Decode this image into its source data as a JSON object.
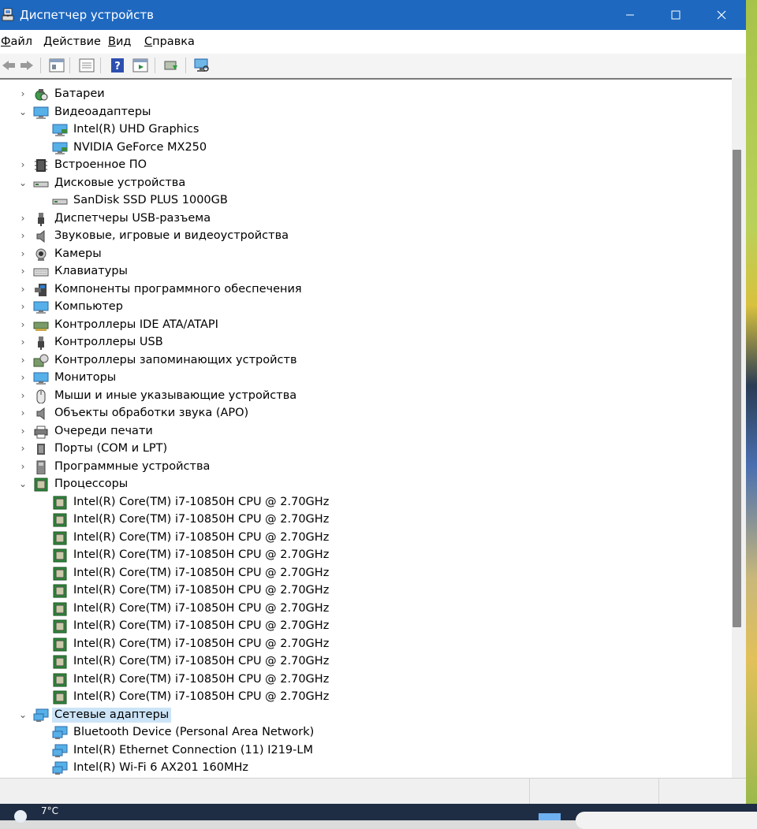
{
  "window": {
    "title": "Диспетчер устройств"
  },
  "menu": [
    {
      "text": "Файл",
      "u": "Ф",
      "rest": "айл"
    },
    {
      "text": "Действие",
      "u": "Д",
      "rest": "ействие"
    },
    {
      "text": "Вид",
      "u": "В",
      "rest": "ид"
    },
    {
      "text": "Справка",
      "u": "С",
      "rest": "правка"
    }
  ],
  "toolbar": [
    "back-icon",
    "forward-icon",
    "properties-icon",
    "show-hide-tree-icon",
    "help-icon",
    "run-icon",
    "update-driver-icon",
    "scan-hardware-icon"
  ],
  "tree": [
    {
      "label": "Батареи",
      "level": 0,
      "state": "collapsed",
      "icon": "battery-icon"
    },
    {
      "label": "Видеоадаптеры",
      "level": 0,
      "state": "expanded",
      "icon": "monitor-icon"
    },
    {
      "label": "Intel(R) UHD Graphics",
      "level": 1,
      "icon": "display-adapter-icon"
    },
    {
      "label": "NVIDIA GeForce MX250",
      "level": 1,
      "icon": "display-adapter-icon"
    },
    {
      "label": "Встроенное ПО",
      "level": 0,
      "state": "collapsed",
      "icon": "firmware-icon"
    },
    {
      "label": "Дисковые устройства",
      "level": 0,
      "state": "expanded",
      "icon": "disk-drive-icon"
    },
    {
      "label": "SanDisk SSD PLUS 1000GB",
      "level": 1,
      "icon": "disk-drive-icon"
    },
    {
      "label": "Диспетчеры USB-разъема",
      "level": 0,
      "state": "collapsed",
      "icon": "usb-icon"
    },
    {
      "label": "Звуковые, игровые и видеоустройства",
      "level": 0,
      "state": "collapsed",
      "icon": "speaker-icon"
    },
    {
      "label": "Камеры",
      "level": 0,
      "state": "collapsed",
      "icon": "camera-icon"
    },
    {
      "label": "Клавиатуры",
      "level": 0,
      "state": "collapsed",
      "icon": "keyboard-icon"
    },
    {
      "label": "Компоненты программного обеспечения",
      "level": 0,
      "state": "collapsed",
      "icon": "software-component-icon"
    },
    {
      "label": "Компьютер",
      "level": 0,
      "state": "collapsed",
      "icon": "monitor-icon"
    },
    {
      "label": "Контроллеры IDE ATA/ATAPI",
      "level": 0,
      "state": "collapsed",
      "icon": "ide-controller-icon"
    },
    {
      "label": "Контроллеры USB",
      "level": 0,
      "state": "collapsed",
      "icon": "usb-icon"
    },
    {
      "label": "Контроллеры запоминающих устройств",
      "level": 0,
      "state": "collapsed",
      "icon": "storage-controller-icon"
    },
    {
      "label": "Мониторы",
      "level": 0,
      "state": "collapsed",
      "icon": "monitor-icon"
    },
    {
      "label": "Мыши и иные указывающие устройства",
      "level": 0,
      "state": "collapsed",
      "icon": "mouse-icon"
    },
    {
      "label": "Объекты обработки звука (APO)",
      "level": 0,
      "state": "collapsed",
      "icon": "speaker-icon"
    },
    {
      "label": "Очереди печати",
      "level": 0,
      "state": "collapsed",
      "icon": "printer-icon"
    },
    {
      "label": "Порты (COM и LPT)",
      "level": 0,
      "state": "collapsed",
      "icon": "port-icon"
    },
    {
      "label": "Программные устройства",
      "level": 0,
      "state": "collapsed",
      "icon": "software-device-icon"
    },
    {
      "label": "Процессоры",
      "level": 0,
      "state": "expanded",
      "icon": "processor-icon"
    },
    {
      "label": "Intel(R) Core(TM) i7-10850H CPU @ 2.70GHz",
      "level": 1,
      "icon": "processor-icon"
    },
    {
      "label": "Intel(R) Core(TM) i7-10850H CPU @ 2.70GHz",
      "level": 1,
      "icon": "processor-icon"
    },
    {
      "label": "Intel(R) Core(TM) i7-10850H CPU @ 2.70GHz",
      "level": 1,
      "icon": "processor-icon"
    },
    {
      "label": "Intel(R) Core(TM) i7-10850H CPU @ 2.70GHz",
      "level": 1,
      "icon": "processor-icon"
    },
    {
      "label": "Intel(R) Core(TM) i7-10850H CPU @ 2.70GHz",
      "level": 1,
      "icon": "processor-icon"
    },
    {
      "label": "Intel(R) Core(TM) i7-10850H CPU @ 2.70GHz",
      "level": 1,
      "icon": "processor-icon"
    },
    {
      "label": "Intel(R) Core(TM) i7-10850H CPU @ 2.70GHz",
      "level": 1,
      "icon": "processor-icon"
    },
    {
      "label": "Intel(R) Core(TM) i7-10850H CPU @ 2.70GHz",
      "level": 1,
      "icon": "processor-icon"
    },
    {
      "label": "Intel(R) Core(TM) i7-10850H CPU @ 2.70GHz",
      "level": 1,
      "icon": "processor-icon"
    },
    {
      "label": "Intel(R) Core(TM) i7-10850H CPU @ 2.70GHz",
      "level": 1,
      "icon": "processor-icon"
    },
    {
      "label": "Intel(R) Core(TM) i7-10850H CPU @ 2.70GHz",
      "level": 1,
      "icon": "processor-icon"
    },
    {
      "label": "Intel(R) Core(TM) i7-10850H CPU @ 2.70GHz",
      "level": 1,
      "icon": "processor-icon"
    },
    {
      "label": "Сетевые адаптеры",
      "level": 0,
      "state": "expanded",
      "icon": "network-adapter-icon",
      "selected": true
    },
    {
      "label": "Bluetooth Device (Personal Area Network)",
      "level": 1,
      "icon": "network-adapter-icon"
    },
    {
      "label": "Intel(R) Ethernet Connection (11) I219-LM",
      "level": 1,
      "icon": "network-adapter-icon"
    },
    {
      "label": "Intel(R) Wi-Fi 6 AX201 160MHz",
      "level": 1,
      "icon": "network-adapter-icon"
    },
    {
      "label": "",
      "level": 1,
      "icon": "network-adapter-icon"
    }
  ],
  "taskbar": {
    "temperature": "7°C"
  },
  "colors": {
    "titlebar": "#1e68c0",
    "selection": "#cce4f7",
    "cpu_green": "#2e8b3a"
  }
}
